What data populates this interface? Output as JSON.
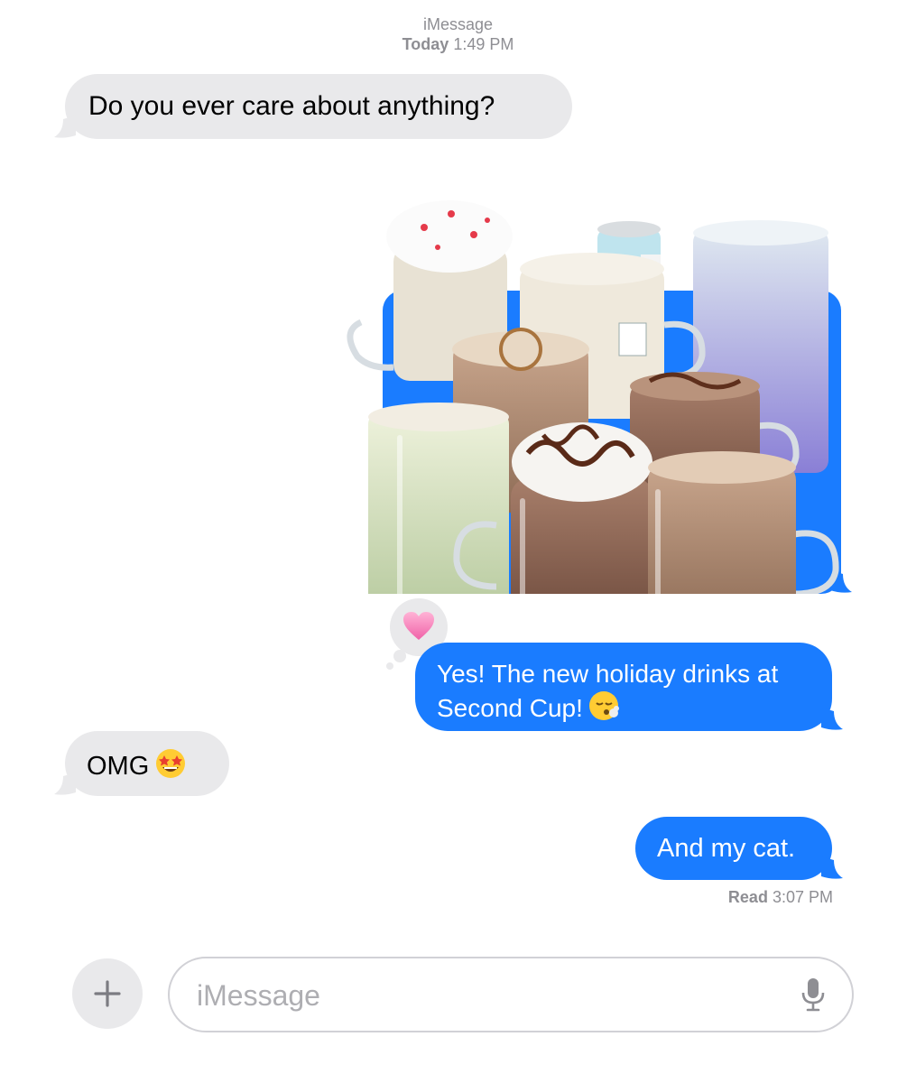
{
  "header": {
    "service": "iMessage",
    "day": "Today",
    "time": "1:49 PM"
  },
  "messages": [
    {
      "direction": "incoming",
      "text": "Do you ever care about anything?"
    },
    {
      "direction": "outgoing",
      "type": "image",
      "image_subject": "holiday drinks"
    },
    {
      "direction": "outgoing",
      "text": "Yes! The new holiday drinks at Second Cup!",
      "emoji": "face-exhaling",
      "tapback": "pink-heart"
    },
    {
      "direction": "incoming",
      "text": "OMG",
      "emoji": "star-struck"
    },
    {
      "direction": "outgoing",
      "text": "And my cat."
    }
  ],
  "read_receipt": {
    "label": "Read",
    "time": "3:07 PM"
  },
  "composer": {
    "placeholder": "iMessage",
    "value": "",
    "plus_icon": "plus-icon",
    "mic_icon": "microphone-icon"
  },
  "colors": {
    "outgoing": "#1a7cff",
    "incoming": "#e9e9eb",
    "meta": "#8e8e93"
  }
}
